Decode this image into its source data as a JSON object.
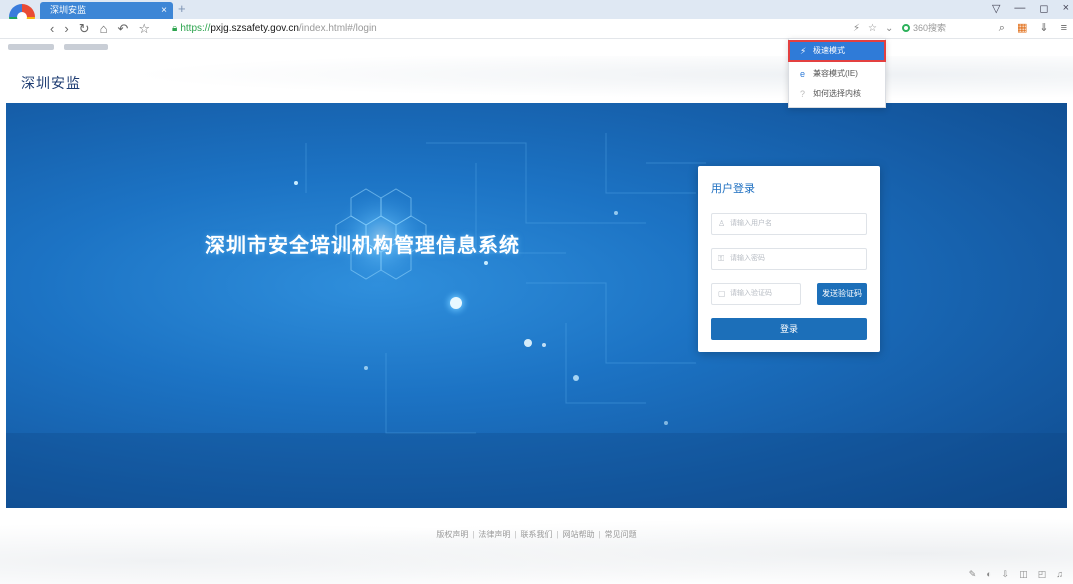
{
  "browser": {
    "tab_title": "深圳安监",
    "tab_close": "×",
    "new_tab": "+",
    "nav": {
      "back": "‹",
      "forward": "›",
      "reload": "↻",
      "home": "⌂",
      "undo": "↶",
      "favorite": "☆"
    },
    "url": {
      "scheme": "https://",
      "host": "pxjg.szsafety.gov.cn",
      "path": "/index.html#/login"
    },
    "addr_icons": {
      "mode": "⚡",
      "star": "☆",
      "dropdown": "⌄"
    },
    "search_placeholder": "360搜索",
    "toolbar_icons": {
      "search": "⌕",
      "apps": "▦",
      "download": "⇓",
      "menu": "≡"
    },
    "window_controls": {
      "skin": "▽",
      "minimize": "—",
      "maximize": "◻",
      "close": "×"
    }
  },
  "dropdown": {
    "items": [
      {
        "icon": "⚡",
        "label": "极速模式",
        "active": true
      },
      {
        "icon": "e",
        "label": "兼容模式(IE)",
        "active": false
      },
      {
        "icon": "?",
        "label": "如何选择内核",
        "active": false
      }
    ]
  },
  "site": {
    "logo": "深圳安监",
    "hero_title": "深圳市安全培训机构管理信息系统"
  },
  "login": {
    "title": "用户登录",
    "username_placeholder": "请输入用户名",
    "password_placeholder": "请输入密码",
    "code_placeholder": "请输入验证码",
    "send_code": "发送验证码",
    "submit": "登录",
    "icons": {
      "user": "♙",
      "lock": "⚿",
      "code": "▢"
    }
  },
  "footer": {
    "links": [
      "版权声明",
      "法律声明",
      "联系我们",
      "网站帮助",
      "常见问题"
    ],
    "separator": "|"
  },
  "status_icons": [
    "✎",
    "◐",
    "⇩",
    "◫",
    "◰",
    "♫"
  ]
}
